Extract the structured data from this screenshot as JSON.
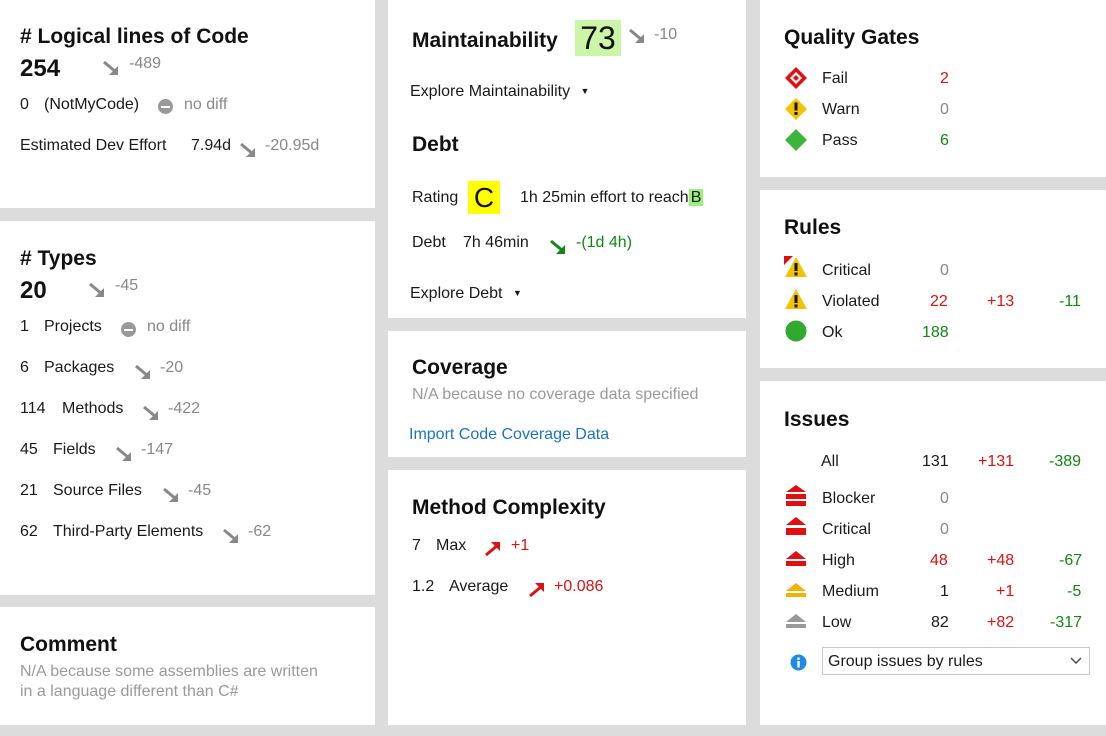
{
  "loc": {
    "title": "# Logical lines of Code",
    "value": "254",
    "delta": "-489",
    "notmycode_value": "0",
    "notmycode_label": "(NotMyCode)",
    "notmycode_diff": "no diff",
    "effort_label": "Estimated Dev Effort",
    "effort_value": "7.94d",
    "effort_delta": "-20.95d"
  },
  "types": {
    "title": "# Types",
    "value": "20",
    "delta": "-45",
    "rows": [
      {
        "value": "1",
        "label": "Projects",
        "diff": "no diff"
      },
      {
        "value": "6",
        "label": "Packages",
        "diff": "-20"
      },
      {
        "value": "114",
        "label": "Methods",
        "diff": "-422"
      },
      {
        "value": "45",
        "label": "Fields",
        "diff": "-147"
      },
      {
        "value": "21",
        "label": "Source Files",
        "diff": "-45"
      },
      {
        "value": "62",
        "label": "Third-Party Elements",
        "diff": "-62"
      }
    ]
  },
  "comment": {
    "title": "Comment",
    "line1": "N/A because some assemblies are written",
    "line2": "in a language different than C#"
  },
  "maintainability": {
    "title": "Maintainability",
    "value": "73",
    "delta": "-10",
    "explore": "Explore Maintainability",
    "value_bg": "#ccf5a8"
  },
  "debt": {
    "title": "Debt",
    "rating_label": "Rating",
    "rating": "C",
    "rating_bg": "#ffff00",
    "effort_text": "1h  25min effort to reach",
    "target": "B",
    "target_bg": "#9bf07a",
    "debt_label": "Debt",
    "debt_value": "7h  46min",
    "debt_delta": "-(1d  4h)",
    "explore": "Explore Debt"
  },
  "coverage": {
    "title": "Coverage",
    "na": "N/A because no coverage data specified",
    "import_link": "Import Code Coverage Data"
  },
  "complexity": {
    "title": "Method Complexity",
    "max_value": "7",
    "max_label": "Max",
    "max_delta": "+1",
    "avg_value": "1.2",
    "avg_label": "Average",
    "avg_delta": "+0.086"
  },
  "quality_gates": {
    "title": "Quality Gates",
    "rows": [
      {
        "label": "Fail",
        "count": "2",
        "icon": "fail-icon",
        "color": "#dd1111"
      },
      {
        "label": "Warn",
        "count": "0",
        "icon": "warn-icon",
        "color": "#888888"
      },
      {
        "label": "Pass",
        "count": "6",
        "icon": "pass-icon",
        "color": "#118811"
      }
    ]
  },
  "rules": {
    "title": "Rules",
    "rows": [
      {
        "label": "Critical",
        "count": "0",
        "added": "",
        "removed": "",
        "icon": "critical-rule-icon"
      },
      {
        "label": "Violated",
        "count": "22",
        "added": "+13",
        "removed": "-11",
        "icon": "violated-rule-icon"
      },
      {
        "label": "Ok",
        "count": "188",
        "added": "",
        "removed": "",
        "icon": "ok-rule-icon"
      }
    ]
  },
  "issues": {
    "title": "Issues",
    "all": {
      "label": "All",
      "count": "131",
      "added": "+131",
      "removed": "-389"
    },
    "rows": [
      {
        "label": "Blocker",
        "count": "0",
        "added": "",
        "removed": "",
        "icon": "blocker-icon"
      },
      {
        "label": "Critical",
        "count": "0",
        "added": "",
        "removed": "",
        "icon": "critical-icon"
      },
      {
        "label": "High",
        "count": "48",
        "added": "+48",
        "removed": "-67",
        "icon": "high-icon"
      },
      {
        "label": "Medium",
        "count": "1",
        "added": "+1",
        "removed": "-5",
        "icon": "medium-icon"
      },
      {
        "label": "Low",
        "count": "82",
        "added": "+82",
        "removed": "-317",
        "icon": "low-icon"
      }
    ],
    "group_select": "Group issues by rules"
  }
}
